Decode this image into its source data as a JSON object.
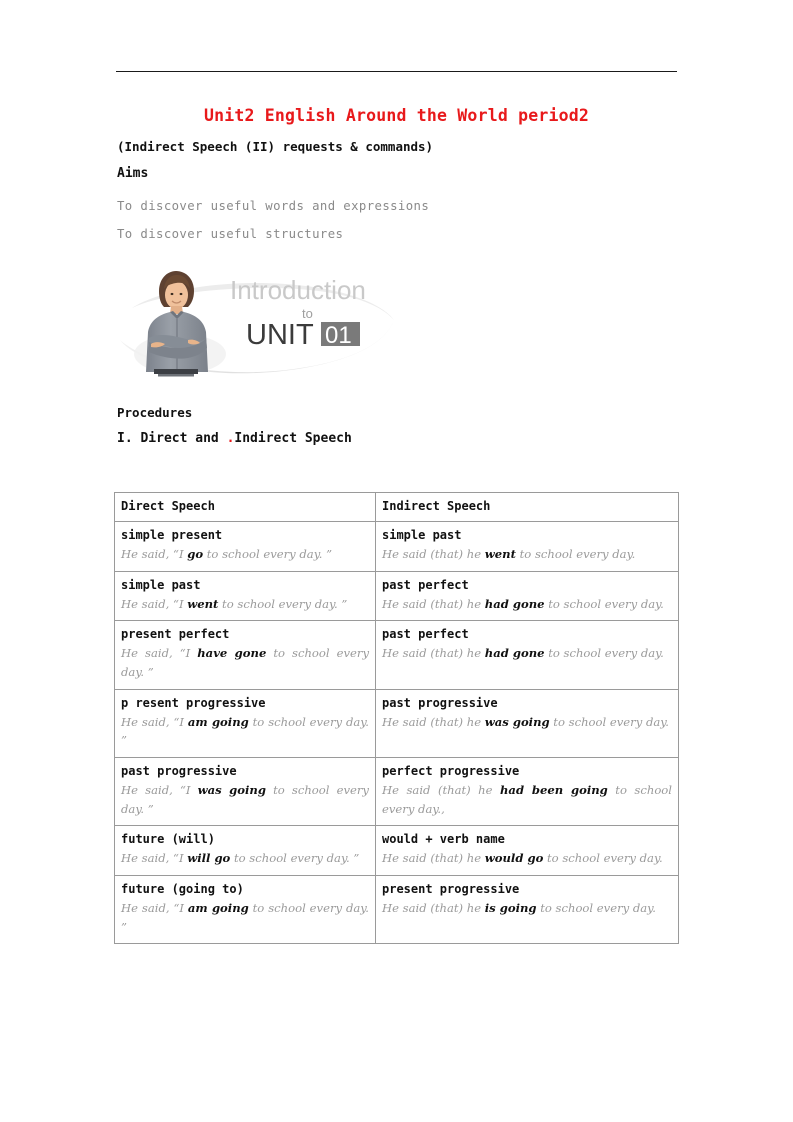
{
  "document": {
    "title": "Unit2 English Around the World period2",
    "subtitle": "(Indirect Speech (II) requests & commands)",
    "aims_heading": "Aims",
    "aims": [
      "To discover useful words and expressions",
      "To discover useful structures"
    ],
    "procedures_heading": "Procedures",
    "section_one": "I. Direct and Indirect Speech",
    "section_one_prefix": "I. Direct and ",
    "section_one_dot": ".",
    "section_one_suffix": "Indirect Speech"
  },
  "illustration": {
    "name": "introduction-to-unit-01-banner",
    "word_introduction": "Introduction",
    "word_to": "to",
    "word_unit": "UNIT",
    "word_number": "01",
    "colors": {
      "introduction_text": "#c9c9c9",
      "unit_text": "#3b3b3b",
      "number_box": "#7a7a7a",
      "number_text": "#ffffff",
      "swoosh": "#e2e2e2",
      "shirt": "#8e939b",
      "hair": "#6b4a33",
      "skin": "#e8b48a"
    }
  },
  "table": {
    "headers": [
      "Direct Speech",
      "Indirect Speech"
    ],
    "rows": [
      {
        "direct_title": "simple present",
        "direct_example_pre": "He said, “I ",
        "direct_example_bold": "go",
        "direct_example_post": " to school every day. ”",
        "indirect_title": "simple past",
        "indirect_example_pre": "He said (that) he ",
        "indirect_example_bold": "went",
        "indirect_example_post": " to school every day."
      },
      {
        "direct_title": "simple past",
        "direct_example_pre": "He said, “I ",
        "direct_example_bold": "went",
        "direct_example_post": " to school every day. ”",
        "indirect_title": "past perfect",
        "indirect_example_pre": "He said (that) he ",
        "indirect_example_bold": "had gone",
        "indirect_example_post": " to school every day."
      },
      {
        "direct_title": "present perfect",
        "direct_example_pre": "He said, “I ",
        "direct_example_bold": "have gone",
        "direct_example_post": " to school every day. ”",
        "indirect_title": "past perfect",
        "indirect_example_pre": "He said (that) he ",
        "indirect_example_bold": "had gone",
        "indirect_example_post": " to school every day."
      },
      {
        "direct_title": "p resent progressive",
        "direct_example_pre": "He said, “I ",
        "direct_example_bold": "am going",
        "direct_example_post": " to school every day. ”",
        "indirect_title": "past progressive",
        "indirect_example_pre": "He said (that) he ",
        "indirect_example_bold": "was going",
        "indirect_example_post": " to school every day."
      },
      {
        "direct_title": "past progressive",
        "direct_example_pre": "He said, “I ",
        "direct_example_bold": "was going",
        "direct_example_post": " to school every day. ”",
        "indirect_title": "perfect progressive",
        "indirect_example_pre": "He said (that) he ",
        "indirect_example_bold": "had been going",
        "indirect_example_post": " to school every day.,"
      },
      {
        "direct_title": "future (will)",
        "direct_example_pre": "He said, “I ",
        "direct_example_bold": "will go",
        "direct_example_post": " to school every day. ”",
        "indirect_title": "would + verb name",
        "indirect_example_pre": "He said (that) he ",
        "indirect_example_bold": "would go",
        "indirect_example_post": " to school every day."
      },
      {
        "direct_title": "future (going to)",
        "direct_example_pre": "He said, “I ",
        "direct_example_bold": "am going",
        "direct_example_post": " to school every day. ”",
        "indirect_title": "present progressive",
        "indirect_example_pre": "He said (that) he ",
        "indirect_example_bold": "is going",
        "indirect_example_post": " to school every day."
      }
    ]
  }
}
